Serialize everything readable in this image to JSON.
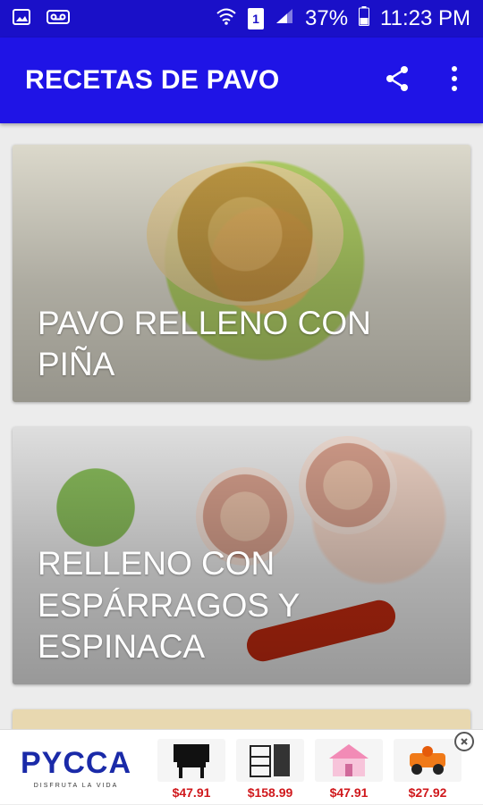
{
  "status": {
    "battery": "37%",
    "time": "11:23 PM",
    "sim": "1"
  },
  "app": {
    "title": "RECETAS DE PAVO"
  },
  "recipes": [
    {
      "title": "PAVO RELLENO CON PIÑA"
    },
    {
      "title": "RELLENO CON ESPÁRRAGOS Y ESPINACA"
    }
  ],
  "ad": {
    "brand": "PYCCA",
    "tagline": "DISFRUTA LA VIDA",
    "items": [
      {
        "price": "$47.91"
      },
      {
        "price": "$158.99"
      },
      {
        "price": "$47.91"
      },
      {
        "price": "$27.92"
      }
    ]
  }
}
